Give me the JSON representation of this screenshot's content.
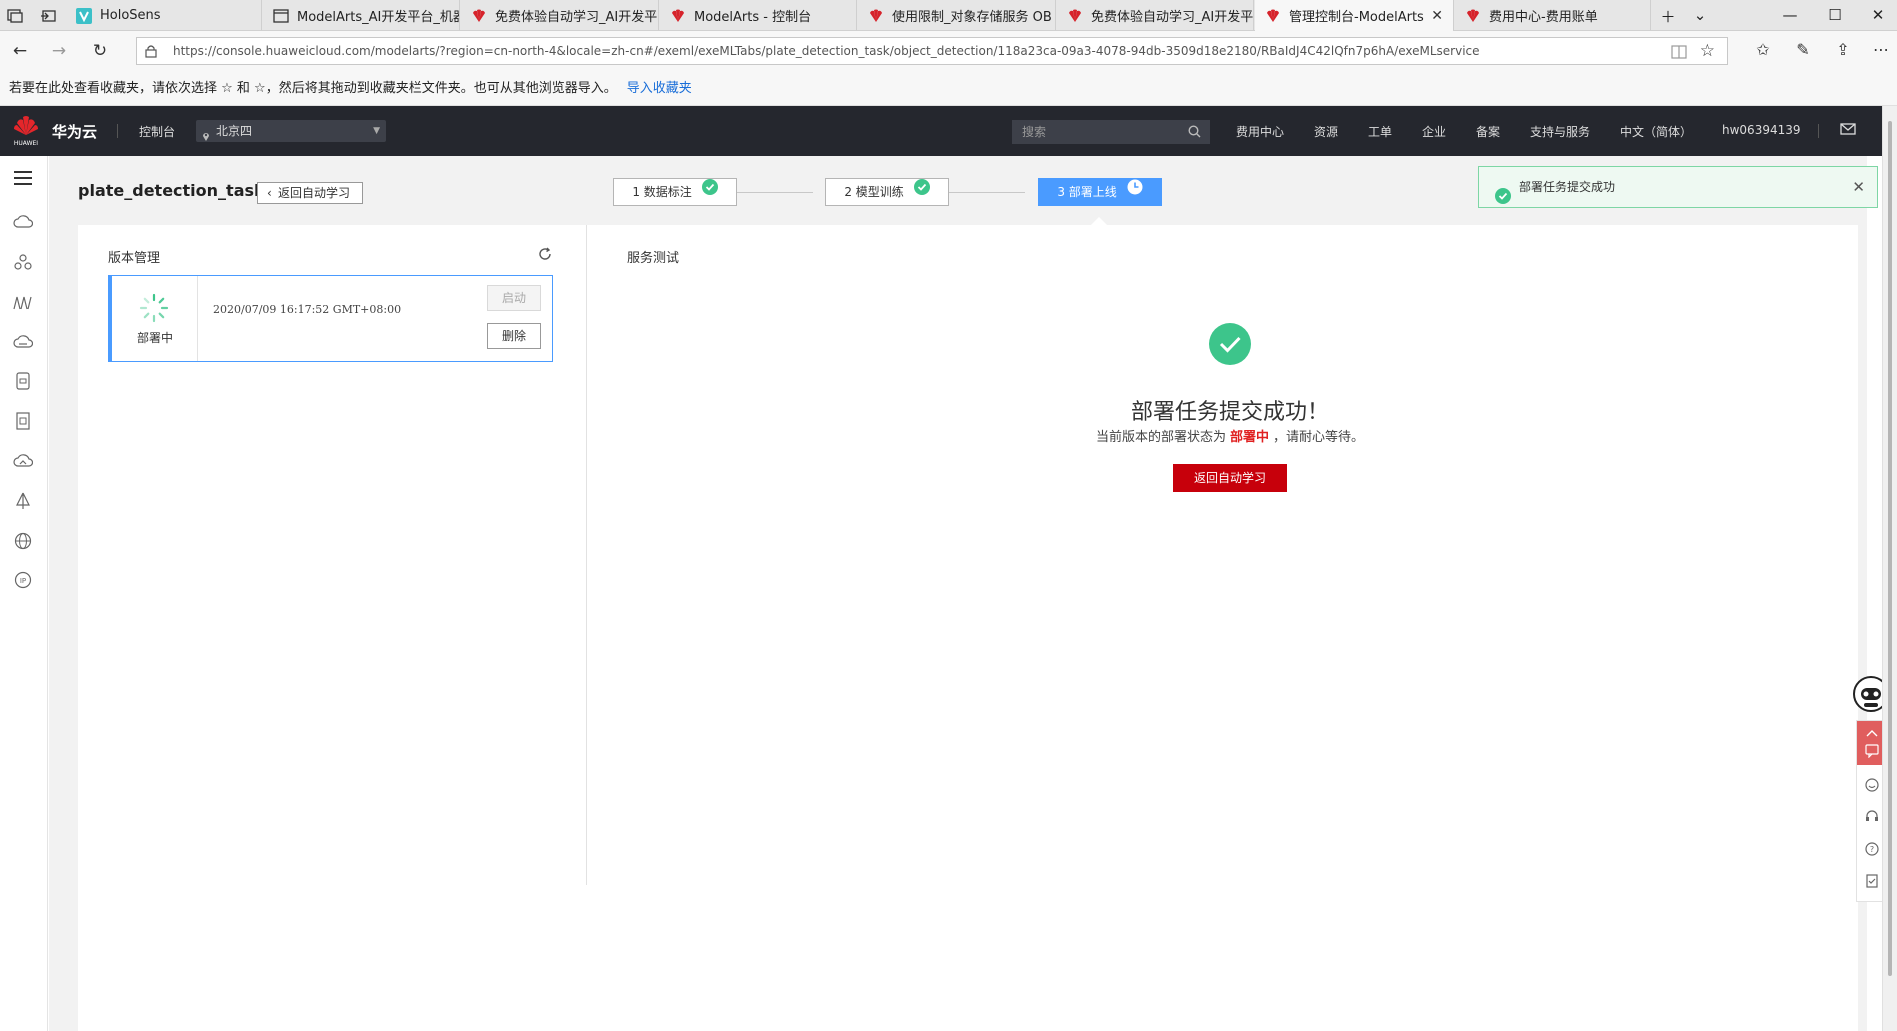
{
  "browser": {
    "tabs": [
      {
        "label": "HoloSens",
        "favicon": "holosens-icon",
        "active": false
      },
      {
        "label": "ModelArts_AI开发平台_机器",
        "favicon": "page-icon",
        "active": false
      },
      {
        "label": "免费体验自动学习_AI开发平",
        "favicon": "huawei-icon",
        "active": false
      },
      {
        "label": "ModelArts - 控制台",
        "favicon": "huawei-icon",
        "active": false
      },
      {
        "label": "使用限制_对象存储服务 OB",
        "favicon": "huawei-icon",
        "active": false
      },
      {
        "label": "免费体验自动学习_AI开发平",
        "favicon": "huawei-icon",
        "active": false
      },
      {
        "label": "管理控制台-ModelArts",
        "favicon": "huawei-icon",
        "active": true
      },
      {
        "label": "费用中心-费用账单",
        "favicon": "huawei-icon",
        "active": false
      }
    ],
    "url": "https://console.huaweicloud.com/modelarts/?region=cn-north-4&locale=zh-cn#/exeml/exeMLTabs/plate_detection_task/object_detection/118a23ca-09a3-4078-94db-3509d18e2180/RBaIdJ4C42lQfn7p6hA/exeMLservice",
    "favorites_hint": "若要在此处查看收藏夹，请依次选择 ☆ 和 ☆，然后将其拖动到收藏夹栏文件夹。也可从其他浏览器导入。",
    "favorites_link": "导入收藏夹"
  },
  "topnav": {
    "brand": "华为云",
    "logo_text": "HUAWEI",
    "console": "控制台",
    "region": "北京四",
    "search_placeholder": "搜索",
    "items": [
      "费用中心",
      "资源",
      "工单",
      "企业",
      "备案",
      "支持与服务",
      "中文（简体）",
      "hw06394139"
    ]
  },
  "sidebar": {
    "icons": [
      "cloud-icon",
      "nodes-icon",
      "chart-icon",
      "cloud-drive-icon",
      "device-icon",
      "document-icon",
      "cloud-sync-icon",
      "deploy-icon",
      "globe-icon",
      "ip-icon"
    ]
  },
  "page": {
    "task_title": "plate_detection_task",
    "back_label": "返回自动学习",
    "steps": [
      {
        "label": "1 数据标注",
        "status": "done"
      },
      {
        "label": "2 模型训练",
        "status": "done"
      },
      {
        "label": "3 部署上线",
        "status": "in-progress"
      }
    ],
    "toast": "部署任务提交成功",
    "version": {
      "title": "版本管理",
      "status": "部署中",
      "time": "2020/07/09 16:17:52 GMT+08:00",
      "start_label": "启动",
      "delete_label": "删除"
    },
    "service": {
      "title": "服务测试",
      "success_title": "部署任务提交成功！",
      "desc_prefix": "当前版本的部署状态为",
      "desc_state": "部署中",
      "desc_suffix": "，请耐心等待。",
      "button": "返回自动学习"
    }
  },
  "colors": {
    "accent_blue": "#4a9bff",
    "success_green": "#3dc58b",
    "brand_red": "#c7000b",
    "nav_dark": "#25272e"
  }
}
